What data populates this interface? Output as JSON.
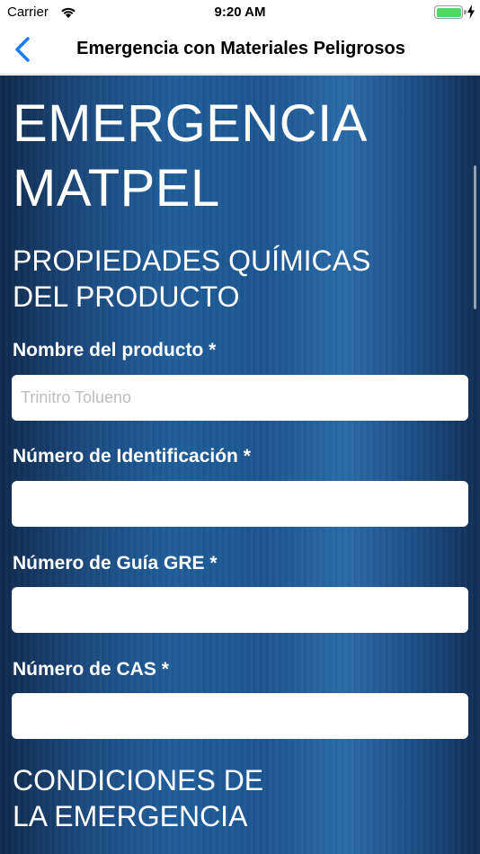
{
  "status_bar": {
    "carrier": "Carrier",
    "time": "9:20 AM",
    "wifi_icon": "wifi-icon",
    "battery_icon": "battery-icon",
    "battery_level": 1.0,
    "charging_icon": "charging-bolt-icon"
  },
  "nav": {
    "back_icon": "chevron-left-icon",
    "title": "Emergencia con Materiales Peligrosos",
    "accent_color": "#1a7cf5"
  },
  "main": {
    "title_line1": "EMERGENCIA",
    "title_line2": "MATPEL",
    "section1": {
      "line1": "PROPIEDADES QUÍMICAS",
      "line2": "DEL PRODUCTO"
    },
    "fields": [
      {
        "label": "Nombre del producto *",
        "placeholder": "Trinitro Tolueno",
        "value": ""
      },
      {
        "label": "Número de Identificación *",
        "placeholder": "",
        "value": ""
      },
      {
        "label": "Número de Guía GRE *",
        "placeholder": "",
        "value": ""
      },
      {
        "label": "Número de CAS *",
        "placeholder": "",
        "value": ""
      }
    ],
    "section2": {
      "line1": "CONDICIONES DE",
      "line2": "LA EMERGENCIA"
    }
  },
  "colors": {
    "background": "#1c5590",
    "text": "#ffffff",
    "input_bg": "#ffffff"
  }
}
